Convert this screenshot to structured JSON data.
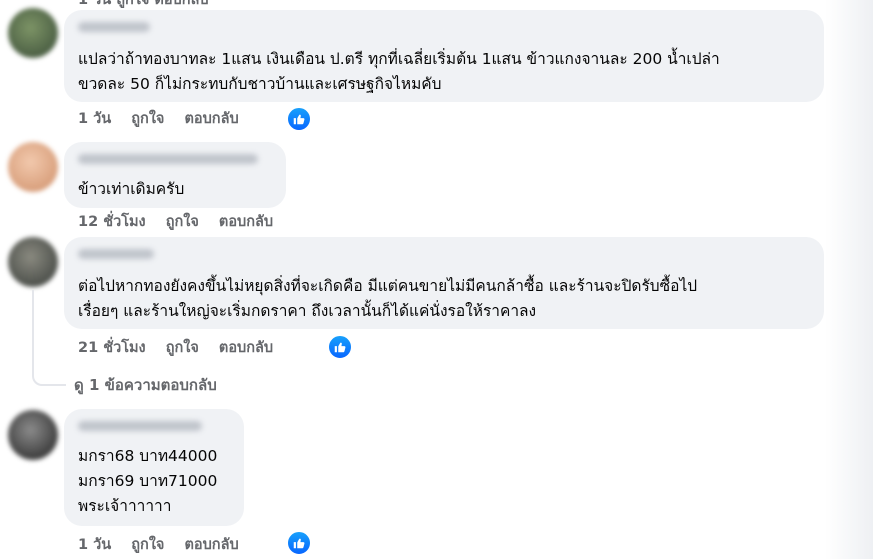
{
  "partial_top_actions": "1 วัน   ถูกใจ   ตอบกลับ",
  "comments": [
    {
      "text": "แปลว่าถ้าทองบาทละ 1แสน เงินเดือน ป.ตรี ทุกที่เฉลี่ยเริ่มต้น 1แสน ข้าวแกงจานละ 200 น้ำเปล่า\nขวดละ 50 ก็ไม่กระทบกับชาวบ้านและเศรษฐกิจไหมคับ",
      "time": "1 วัน",
      "like": "ถูกใจ",
      "reply": "ตอบกลับ",
      "reaction": "like-icon"
    },
    {
      "text": "ข้าวเท่าเดิมครับ",
      "time": "12 ชั่วโมง",
      "like": "ถูกใจ",
      "reply": "ตอบกลับ"
    },
    {
      "text": "ต่อไปหากทองยังคงขึ้นไม่หยุดสิ่งที่จะเกิดคือ มีแต่คนขายไม่มีคนกล้าซื้อ และร้านจะปิดรับซื้อไป\nเรื่อยๆ และร้านใหญ่จะเริ่มกดราคา ถึงเวลานั้นก็ได้แค่นั่งรอให้ราคาลง",
      "time": "21 ชั่วโมง",
      "like": "ถูกใจ",
      "reply": "ตอบกลับ",
      "reaction": "like-icon"
    },
    {
      "text": "มกรา68 บาท44000\nมกรา69 บาท71000\nพระเจ้าาาาาา",
      "time": "1 วัน",
      "like": "ถูกใจ",
      "reply": "ตอบกลับ",
      "reaction": "like-icon"
    }
  ],
  "view_replies": "ดู 1 ข้อความตอบกลับ",
  "colors": {
    "bubble": "#f0f2f5",
    "meta_text": "#65676b",
    "like_blue": "#0866ff"
  }
}
